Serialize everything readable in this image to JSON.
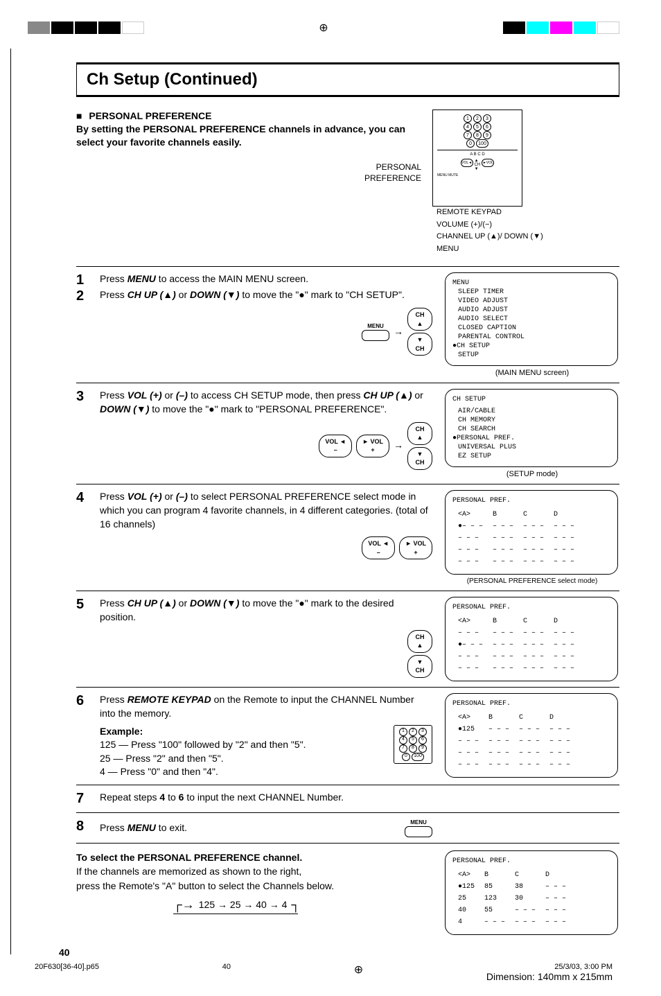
{
  "header": {
    "title": "Ch Setup (Continued)"
  },
  "intro": {
    "heading": "PERSONAL PREFERENCE",
    "body": "By setting the PERSONAL PREFERENCE channels in advance, you can select your favorite channels easily.",
    "label_personal": "PERSONAL",
    "label_preference": "PREFERENCE"
  },
  "remote": {
    "keypad": "REMOTE KEYPAD",
    "volume": "VOLUME (+)/(−)",
    "channel": "CHANNEL UP (▲)/ DOWN (▼)",
    "menu": "MENU"
  },
  "steps": [
    {
      "num": "1",
      "text_parts": [
        "Press ",
        "MENU",
        " to access the MAIN MENU screen."
      ]
    },
    {
      "num": "2",
      "text_parts": [
        "Press ",
        "CH UP (▲)",
        " or ",
        "DOWN (▼)",
        " to move the \"●\" mark to \"CH SETUP\"."
      ]
    },
    {
      "num": "3",
      "text_parts": [
        "Press ",
        "VOL (+)",
        " or ",
        "(–)",
        " to access CH SETUP mode, then press ",
        "CH UP (▲)",
        " or ",
        "DOWN (▼)",
        " to move the \"●\" mark to \"PERSONAL PREFERENCE\"."
      ]
    },
    {
      "num": "4",
      "text_parts": [
        "Press ",
        "VOL (+)",
        " or ",
        "(–)",
        " to select PERSONAL PREFERENCE select mode in which you can program 4 favorite channels, in 4 different categories. (total of 16 channels)"
      ]
    },
    {
      "num": "5",
      "text_parts": [
        "Press ",
        "CH UP (▲)",
        " or ",
        "DOWN (▼)",
        " to move the \"●\" mark to the desired position."
      ]
    },
    {
      "num": "6",
      "text_parts": [
        "Press ",
        "REMOTE KEYPAD",
        " on the Remote to input the CHANNEL Number into the memory."
      ],
      "example_label": "Example:",
      "example_lines": [
        "125 — Press \"100\" followed by \"2\" and then \"5\".",
        "25  — Press \"2\" and then \"5\".",
        "4   — Press \"0\" and then \"4\"."
      ]
    },
    {
      "num": "7",
      "text_parts": [
        "Repeat steps ",
        "4",
        " to ",
        "6",
        " to input the next CHANNEL Number."
      ]
    },
    {
      "num": "8",
      "text_parts": [
        "Press ",
        "MENU",
        " to exit."
      ]
    }
  ],
  "icons": {
    "menu_label": "MENU",
    "ch_up": "CH\n▲",
    "ch_down": "▼\nCH",
    "vol_minus": "VOL ◄\n–",
    "vol_plus": "► VOL\n+"
  },
  "screens": {
    "main_menu": {
      "title": "MENU",
      "items": [
        "SLEEP TIMER",
        "VIDEO ADJUST",
        "AUDIO ADJUST",
        "AUDIO SELECT",
        "CLOSED CAPTION",
        "PARENTAL CONTROL",
        "●CH SETUP",
        "SETUP"
      ],
      "caption": "(MAIN MENU screen)"
    },
    "setup": {
      "title": "CH SETUP",
      "items": [
        "AIR/CABLE",
        "CH MEMORY",
        "CH SEARCH",
        "●PERSONAL PREF.",
        "UNIVERSAL PLUS",
        "EZ SETUP"
      ],
      "caption": "(SETUP mode)"
    },
    "pref_select": {
      "title": "PERSONAL PREF.",
      "cols": [
        "<A>",
        "B",
        "C",
        "D"
      ],
      "rows": [
        [
          "●– – –",
          "– – –",
          "– – –",
          "– – –"
        ],
        [
          "– – –",
          "– – –",
          "– – –",
          "– – –"
        ],
        [
          "– – –",
          "– – –",
          "– – –",
          "– – –"
        ],
        [
          "– – –",
          "– – –",
          "– – –",
          "– – –"
        ]
      ],
      "caption": "(PERSONAL PREFERENCE select mode)"
    },
    "pref_pos": {
      "title": "PERSONAL PREF.",
      "cols": [
        "<A>",
        "B",
        "C",
        "D"
      ],
      "rows": [
        [
          "– – –",
          "– – –",
          "– – –",
          "– – –"
        ],
        [
          "●– – –",
          "– – –",
          "– – –",
          "– – –"
        ],
        [
          "– – –",
          "– – –",
          "– – –",
          "– – –"
        ],
        [
          "– – –",
          "– – –",
          "– – –",
          "– – –"
        ]
      ]
    },
    "pref_input": {
      "title": "PERSONAL PREF.",
      "cols": [
        "<A>",
        "B",
        "C",
        "D"
      ],
      "rows": [
        [
          "●125",
          "– – –",
          "– – –",
          "– – –"
        ],
        [
          "– – –",
          "– – –",
          "– – –",
          "– – –"
        ],
        [
          "– – –",
          "– – –",
          "– – –",
          "– – –"
        ],
        [
          "– – –",
          "– – –",
          "– – –",
          "– – –"
        ]
      ]
    },
    "pref_final": {
      "title": "PERSONAL PREF.",
      "cols": [
        "<A>",
        "B",
        "C",
        "D"
      ],
      "rows": [
        [
          "●125",
          "85",
          "38",
          "– – –"
        ],
        [
          "25",
          "123",
          "30",
          "– – –"
        ],
        [
          "40",
          "55",
          "– – –",
          "– – –"
        ],
        [
          "4",
          "– – –",
          "– – –",
          "– – –"
        ]
      ]
    }
  },
  "select_section": {
    "heading": "To select the PERSONAL PREFERENCE channel.",
    "line1": "If the channels are memorized as shown to the right,",
    "line2": "press the Remote's \"A\" button to select the Channels below.",
    "cycle": "125 → 25 → 40 → 4"
  },
  "page_number": "40",
  "footer": {
    "file": "20F630[36-40].p65",
    "page": "40",
    "date": "25/3/03, 3:00 PM",
    "dim": "Dimension: 140mm x 215mm"
  }
}
